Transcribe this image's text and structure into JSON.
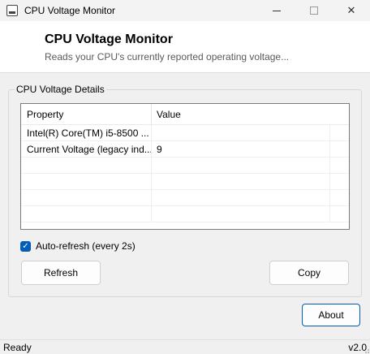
{
  "window": {
    "title": "CPU Voltage Monitor",
    "controls": {
      "minimize": "minimize",
      "maximize": "maximize",
      "close": "✕"
    }
  },
  "header": {
    "title": "CPU Voltage Monitor",
    "subtitle": "Reads your CPU's currently reported operating voltage..."
  },
  "group": {
    "legend": "CPU Voltage Details",
    "columns": [
      "Property",
      "Value"
    ],
    "rows": [
      {
        "property": "Intel(R) Core(TM) i5-8500 ...",
        "value": ""
      },
      {
        "property": "Current Voltage (legacy ind...",
        "value": "9"
      },
      {
        "property": "",
        "value": ""
      },
      {
        "property": "",
        "value": ""
      },
      {
        "property": "",
        "value": ""
      },
      {
        "property": "",
        "value": ""
      }
    ],
    "auto_refresh": {
      "label": "Auto-refresh (every 2s)",
      "checked": true,
      "check_glyph": "✓"
    },
    "refresh_label": "Refresh",
    "copy_label": "Copy"
  },
  "about_label": "About",
  "status": {
    "text": "Ready",
    "version": "v2.0"
  },
  "colors": {
    "accent": "#005fb8",
    "header_bg": "#ffffff",
    "window_bg": "#f0f0f0"
  }
}
